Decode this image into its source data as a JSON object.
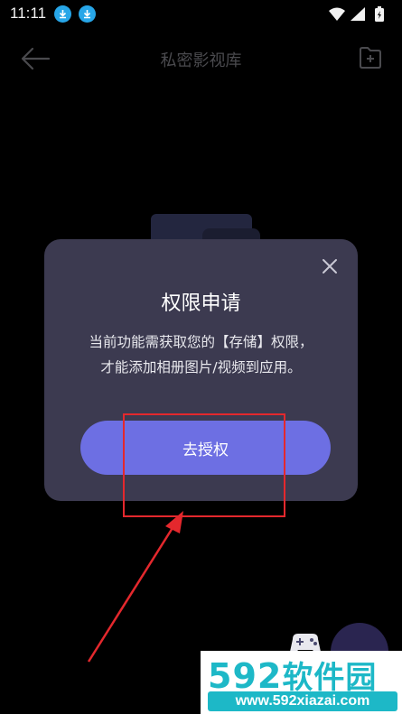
{
  "status_bar": {
    "time": "11:11",
    "icons": [
      "download-icon",
      "download-icon",
      "wifi-icon",
      "signal-icon",
      "battery-icon"
    ]
  },
  "header": {
    "title": "私密影视库",
    "back_icon": "arrow-left-icon",
    "add_icon": "add-folder-icon"
  },
  "dialog": {
    "title": "权限申请",
    "message_line1": "当前功能需获取您的【存储】权限，",
    "message_line2": "才能添加相册图片/视频到应用。",
    "grant_button": "去授权",
    "close_icon": "close-icon"
  },
  "watermark": {
    "number": "592",
    "name": "软件园",
    "url": "www.592xiazai.com"
  },
  "colors": {
    "background": "#000000",
    "dialog": "#3c3a50",
    "button": "#6d6fe3",
    "annotation": "#e4282d",
    "watermark": "#1db8c7"
  }
}
